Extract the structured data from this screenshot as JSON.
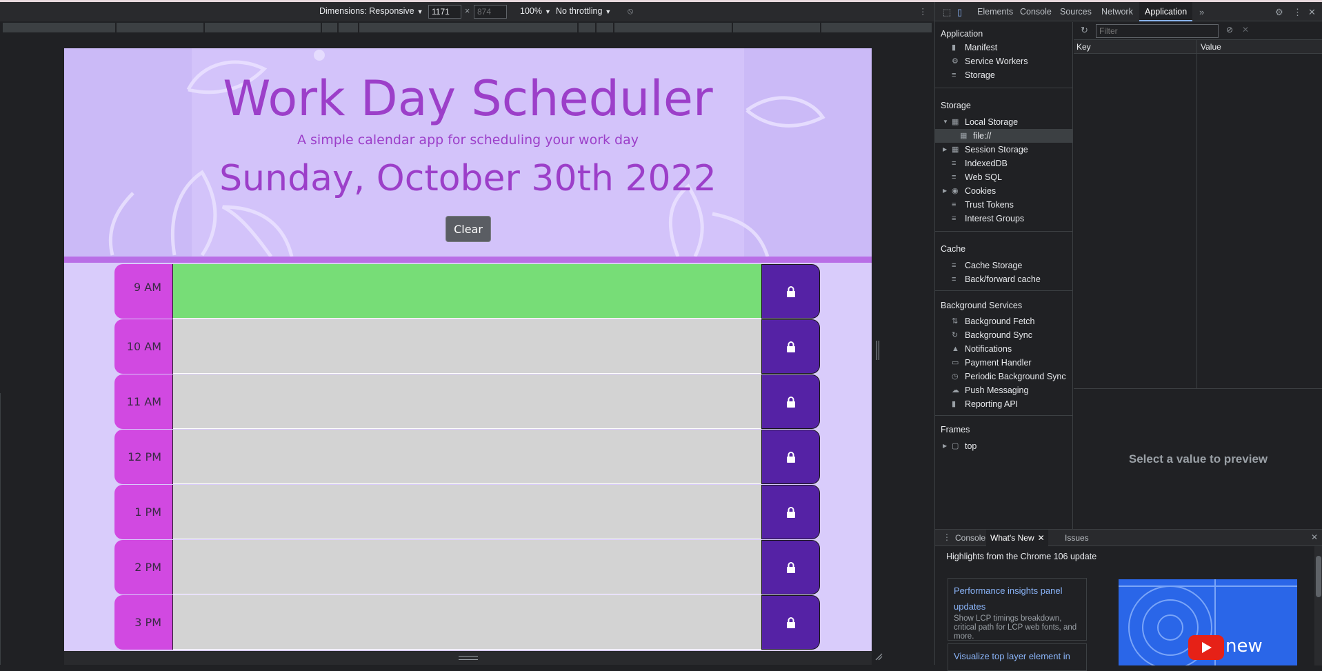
{
  "device_toolbar": {
    "dimensions_label": "Dimensions: Responsive",
    "width": "1171",
    "height": "874",
    "zoom": "100%",
    "throttling": "No throttling"
  },
  "app": {
    "title": "Work Day Scheduler",
    "subtitle": "A simple calendar app for scheduling your work day",
    "current_date": "Sunday, October 30th 2022",
    "clear_label": "Clear",
    "colors": {
      "accent": "#9c3fc9",
      "hour_block": "#d149e1",
      "save_button": "#5522a5",
      "present": "#77dd77",
      "future": "#d3d3d3"
    },
    "time_blocks": [
      {
        "hour": "9 AM",
        "state": "present",
        "text": ""
      },
      {
        "hour": "10 AM",
        "state": "future",
        "text": ""
      },
      {
        "hour": "11 AM",
        "state": "future",
        "text": ""
      },
      {
        "hour": "12 PM",
        "state": "future",
        "text": ""
      },
      {
        "hour": "1 PM",
        "state": "future",
        "text": ""
      },
      {
        "hour": "2 PM",
        "state": "future",
        "text": ""
      },
      {
        "hour": "3 PM",
        "state": "future",
        "text": ""
      }
    ],
    "save_icon": "lock-icon"
  },
  "devtools": {
    "tabs": [
      "Elements",
      "Console",
      "Sources",
      "Network",
      "Application"
    ],
    "active_tab": "Application",
    "sidebar": {
      "application_head": "Application",
      "application_items": [
        "Manifest",
        "Service Workers",
        "Storage"
      ],
      "storage_head": "Storage",
      "storage_items": {
        "local_storage": "Local Storage",
        "local_storage_child": "file://",
        "session_storage": "Session Storage",
        "indexeddb": "IndexedDB",
        "websql": "Web SQL",
        "cookies": "Cookies",
        "trust_tokens": "Trust Tokens",
        "interest_groups": "Interest Groups"
      },
      "cache_head": "Cache",
      "cache_items": [
        "Cache Storage",
        "Back/forward cache"
      ],
      "bg_head": "Background Services",
      "bg_items": [
        "Background Fetch",
        "Background Sync",
        "Notifications",
        "Payment Handler",
        "Periodic Background Sync",
        "Push Messaging",
        "Reporting API"
      ],
      "frames_head": "Frames",
      "frames_items": [
        "top"
      ]
    },
    "storage_table": {
      "filter_placeholder": "Filter",
      "col_key": "Key",
      "col_value": "Value",
      "preview_text": "Select a value to preview"
    },
    "drawer": {
      "tabs": [
        "Console",
        "What's New",
        "Issues"
      ],
      "active_tab": "What's New",
      "headline": "Highlights from the Chrome 106 update",
      "cards": [
        {
          "title": "Performance insights panel updates",
          "desc": "Show LCP timings breakdown, critical path for LCP web fonts, and more."
        },
        {
          "title": "Visualize top layer element in",
          "desc": ""
        }
      ],
      "thumbnail_text": "new"
    }
  }
}
